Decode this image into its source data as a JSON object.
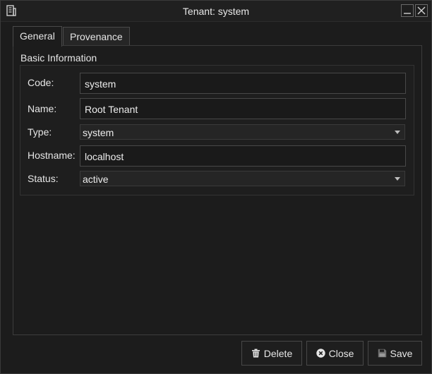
{
  "window": {
    "title": "Tenant: system",
    "icons": {
      "app": "server-building-icon",
      "minimize": "minimize-icon",
      "close": "close-icon"
    }
  },
  "tabs": [
    {
      "label": "General",
      "active": true
    },
    {
      "label": "Provenance",
      "active": false
    }
  ],
  "group": {
    "title": "Basic Information",
    "fields": {
      "code": {
        "label": "Code:",
        "value": "system"
      },
      "name": {
        "label": "Name:",
        "value": "Root Tenant"
      },
      "type": {
        "label": "Type:",
        "value": "system"
      },
      "hostname": {
        "label": "Hostname:",
        "value": "localhost"
      },
      "status": {
        "label": "Status:",
        "value": "active"
      }
    }
  },
  "buttons": {
    "delete": {
      "label": "Delete",
      "icon": "trash-icon"
    },
    "close": {
      "label": "Close",
      "icon": "close-circle-icon"
    },
    "save": {
      "label": "Save",
      "icon": "floppy-disk-icon",
      "enabled": false
    }
  },
  "colors": {
    "background": "#1c1c1c",
    "border": "#484848",
    "text": "#e6e6e6"
  }
}
